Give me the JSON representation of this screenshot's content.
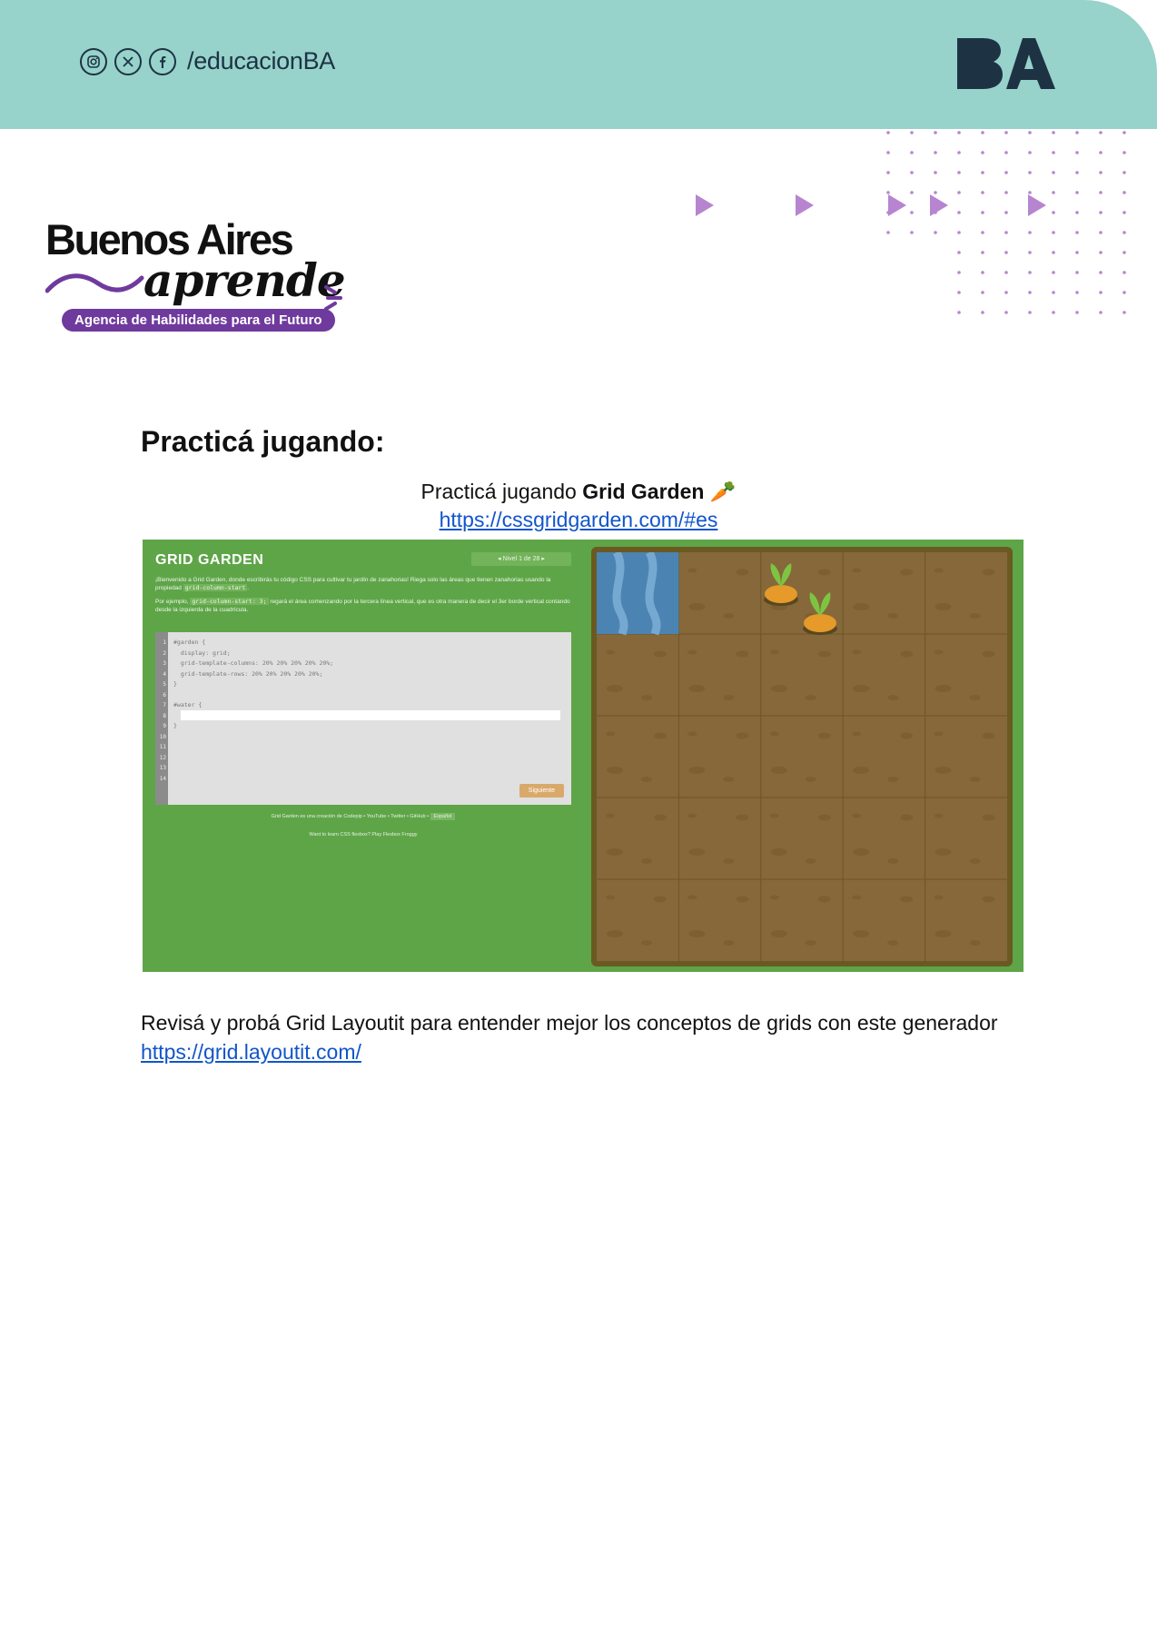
{
  "header": {
    "social_handle": "/educacionBA",
    "social_icons": [
      "instagram-icon",
      "x-icon",
      "facebook-icon"
    ],
    "logo_text": "BA",
    "colors": {
      "band": "#97d2cb",
      "ink": "#1d3344"
    }
  },
  "brand": {
    "line1": "Buenos Aires",
    "line2": "aprende",
    "tagline": "Agencia de Habilidades para el Futuro",
    "accent": "#6f3a9d"
  },
  "section_title": "Practicá jugando:",
  "intro": {
    "prefix": "Practicá jugando ",
    "game_name": "Grid Garden",
    "emoji": "🥕"
  },
  "game_link": "https://cssgridgarden.com/#es",
  "game_screenshot": {
    "title": "GRID GARDEN",
    "level": "Nivel 1 de 28",
    "description_1": "¡Bienvenido a Grid Garden, donde escribirás tu código CSS para cultivar tu jardín de zanahorias! Riega solo las áreas que tienen zanahorias usando la propiedad",
    "description_1_code": "grid-column-start",
    "description_2_prefix": "Por ejemplo,",
    "description_2_code": "grid-column-start: 3;",
    "description_2_suffix": "regará el área comenzando por la tercera línea vertical, que es otra manera de decir el 3er borde vertical contando desde la izquierda de la cuadrícula.",
    "code_lines": [
      "#garden {",
      "  display: grid;",
      "  grid-template-columns: 20% 20% 20% 20% 20%;",
      "  grid-template-rows: 20% 20% 20% 20% 20%;",
      "}",
      "",
      "#water {",
      "",
      "}"
    ],
    "line_numbers": [
      "1",
      "2",
      "3",
      "4",
      "5",
      "6",
      "7",
      "8",
      "9",
      "10",
      "11",
      "12",
      "13",
      "14"
    ],
    "next_button": "Siguiente",
    "footer_1": "Grid Garden es una creación de Codepip • YouTube • Twitter • GitHub •",
    "footer_1_lang": "Español",
    "footer_2": "Want to learn CSS flexbox? Play Flexbox Froggy",
    "colors": {
      "background": "#5ea548",
      "soil": "#86683a",
      "water": "#4b84b3",
      "carrot": "#e59a2a",
      "leaf": "#7dc443"
    }
  },
  "paragraph": "Revisá y probá Grid Layoutit para entender mejor los conceptos de grids con este generador",
  "layoutit_link": "https://grid.layoutit.com/"
}
